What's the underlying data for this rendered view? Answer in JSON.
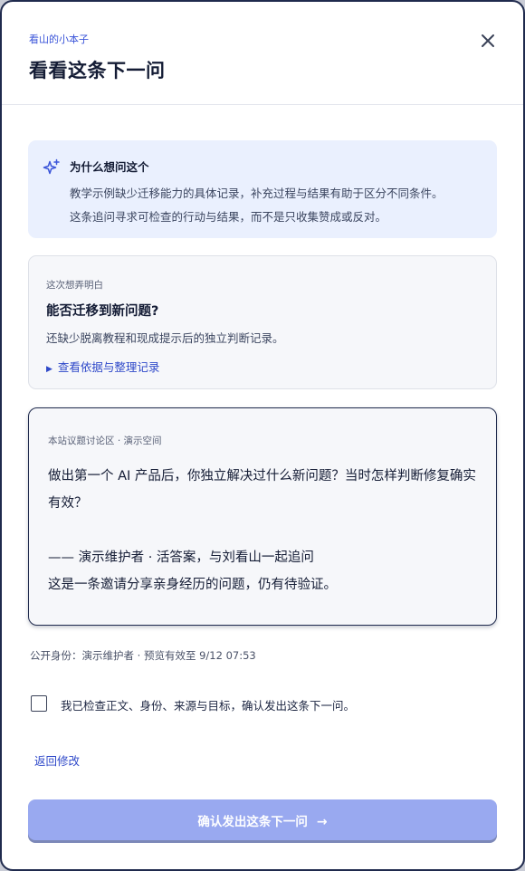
{
  "header": {
    "eyebrow": "看山的小本子",
    "title": "看看这条下一问",
    "close_icon": "close-icon"
  },
  "why": {
    "icon": "sparkle-icon",
    "heading": "为什么想问这个",
    "line1": "教学示例缺少迁移能力的具体记录，补充过程与结果有助于区分不同条件。",
    "line2": "这条追问寻求可检查的行动与结果，而不是只收集赞成或反对。"
  },
  "clarify": {
    "label": "这次想弄明白",
    "question": "能否迁移到新问题?",
    "detail": "还缺少脱离教程和现成提示后的独立判断记录。",
    "link_marker": "▶",
    "link": "查看依据与整理记录"
  },
  "quote": {
    "label": "本站议题讨论区 · 演示空间",
    "question": "做出第一个 AI 产品后，你独立解决过什么新问题？当时怎样判断修复确实有效？",
    "signature": "—— 演示维护者 · 活答案，与刘看山一起追问",
    "note": "这是一条邀请分享亲身经历的问题，仍有待验证。"
  },
  "identity": "公开身份：演示维护者 · 预览有效至 9/12 07:53",
  "confirm_check": {
    "label": "我已检查正文、身份、来源与目标，确认发出这条下一问。",
    "checked": false
  },
  "back_link": "返回修改",
  "submit": {
    "label": "确认发出这条下一问",
    "arrow": "→"
  },
  "colors": {
    "accent": "#3b55d9",
    "submit_disabled": "#99a9f0",
    "info_bg": "#eaf0fe",
    "border_dark": "#1f2a4d"
  }
}
